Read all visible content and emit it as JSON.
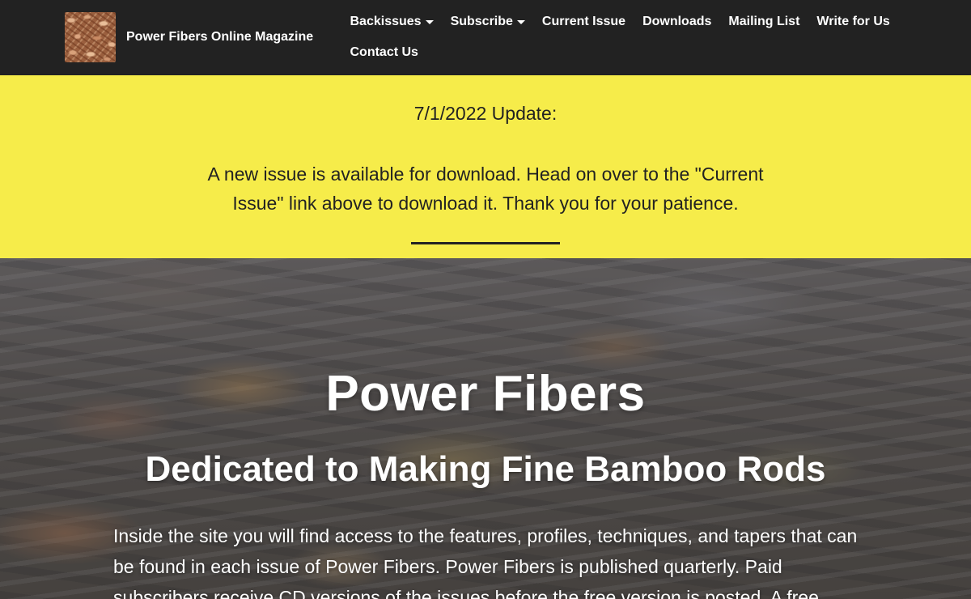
{
  "brand": {
    "logo_icon": "woven-fibers-logo-icon",
    "name": "Power Fibers Online Magazine"
  },
  "nav": {
    "items": [
      {
        "label": "Backissues",
        "dropdown": true
      },
      {
        "label": "Subscribe",
        "dropdown": true
      },
      {
        "label": "Current Issue",
        "dropdown": false
      },
      {
        "label": "Downloads",
        "dropdown": false
      },
      {
        "label": "Mailing List",
        "dropdown": false
      },
      {
        "label": "Write for Us",
        "dropdown": false
      },
      {
        "label": "Contact Us",
        "dropdown": false
      }
    ]
  },
  "announcement": {
    "title": "7/1/2022 Update:",
    "body": "A new issue is available for download. Head on over to the \"Current Issue\" link above to download it. Thank you for your patience."
  },
  "hero": {
    "title": "Power Fibers",
    "subtitle": "Dedicated to Making Fine Bamboo Rods",
    "text": "Inside the site you will find access to the features, profiles, techniques, and tapers that can be found in each issue of Power Fibers. Power Fibers is published quarterly. Paid subscribers receive CD versions of the issues before the free version is posted. A free"
  },
  "colors": {
    "navbar_bg": "#222222",
    "announcement_bg": "#f6ec4a",
    "text_dark": "#222222",
    "text_light": "#ffffff"
  }
}
